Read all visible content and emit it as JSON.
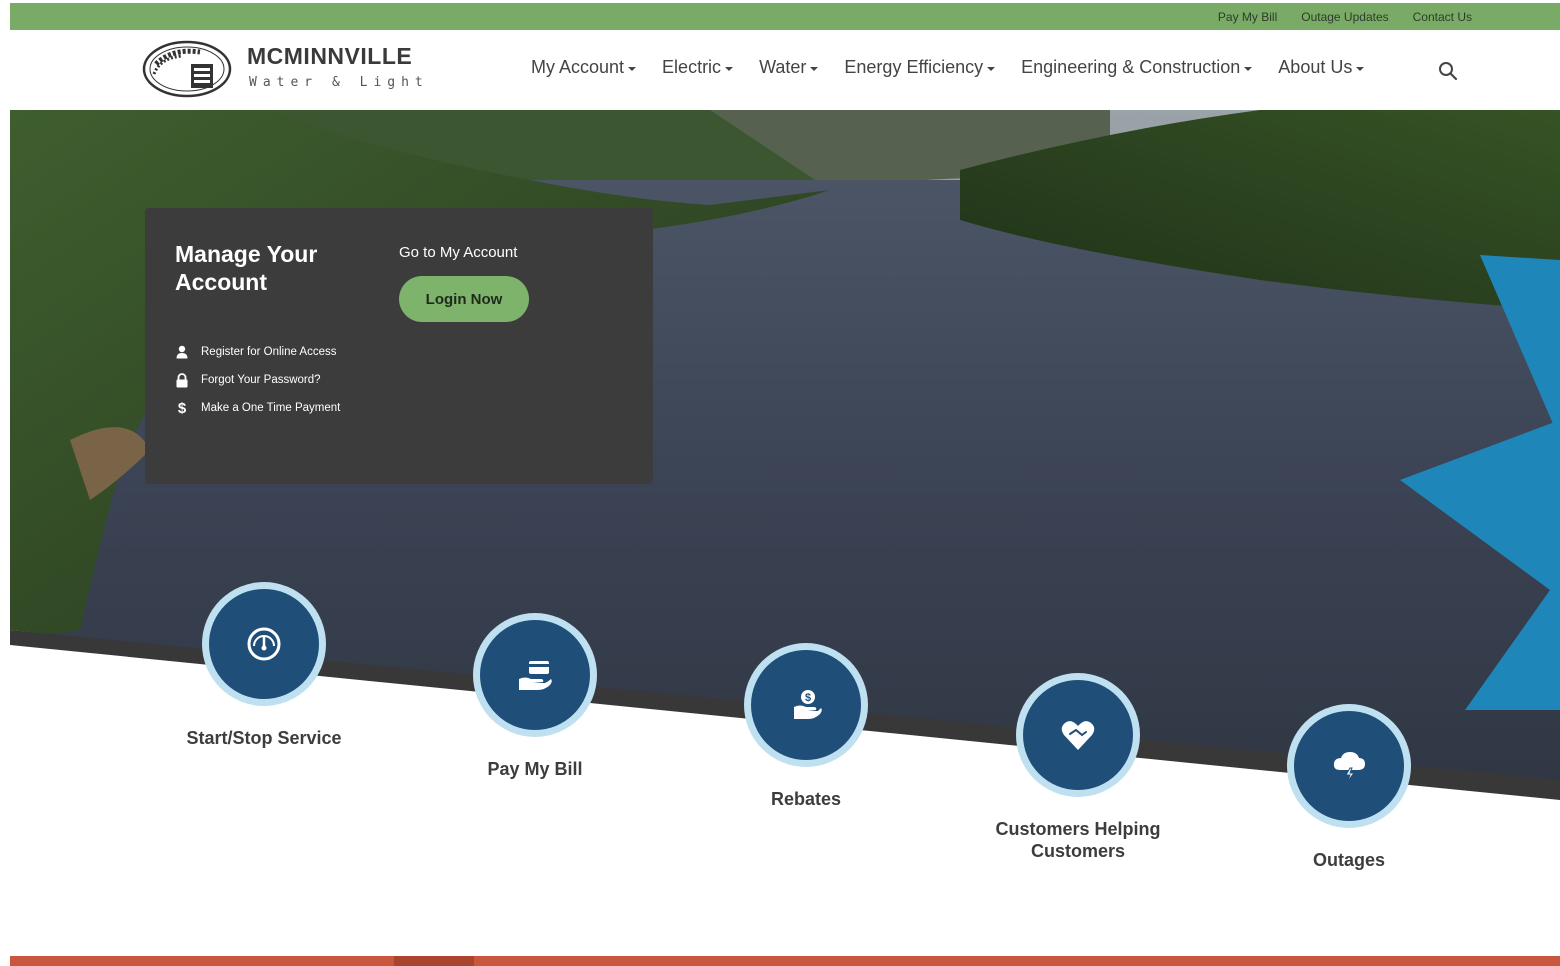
{
  "utility": {
    "links": [
      "Pay My Bill",
      "Outage Updates",
      "Contact Us"
    ]
  },
  "brand": {
    "name": "MCMINNVILLE",
    "tagline": "Water & Light",
    "seal_text": "McMinnville Water & Light Since 1889",
    "accent_green": "#7aab66",
    "primary_navy": "#1f4e79",
    "light_blue": "#bfe0f0",
    "panel_gray": "#3c3c3d",
    "footer_red": "#c8573e"
  },
  "nav": {
    "items": [
      "My Account",
      "Electric",
      "Water",
      "Energy Efficiency",
      "Engineering & Construction",
      "About Us"
    ],
    "search_icon": "search-icon"
  },
  "account_panel": {
    "title": "Manage Your Account",
    "goto_text": "Go to My Account",
    "login_label": "Login Now",
    "links": [
      {
        "icon": "user-icon",
        "label": "Register for Online Access"
      },
      {
        "icon": "lock-icon",
        "label": "Forgot Your Password?"
      },
      {
        "icon": "dollar-icon",
        "label": "Make a One Time Payment"
      }
    ]
  },
  "quick_links": [
    {
      "label": "Start/Stop Service",
      "icon": "gauge-icon"
    },
    {
      "label": "Pay My Bill",
      "icon": "hand-card-icon"
    },
    {
      "label": "Rebates",
      "icon": "hand-money-icon"
    },
    {
      "label": "Customers Helping Customers",
      "icon": "heart-handshake-icon"
    },
    {
      "label": "Outages",
      "icon": "storm-cloud-icon"
    }
  ]
}
